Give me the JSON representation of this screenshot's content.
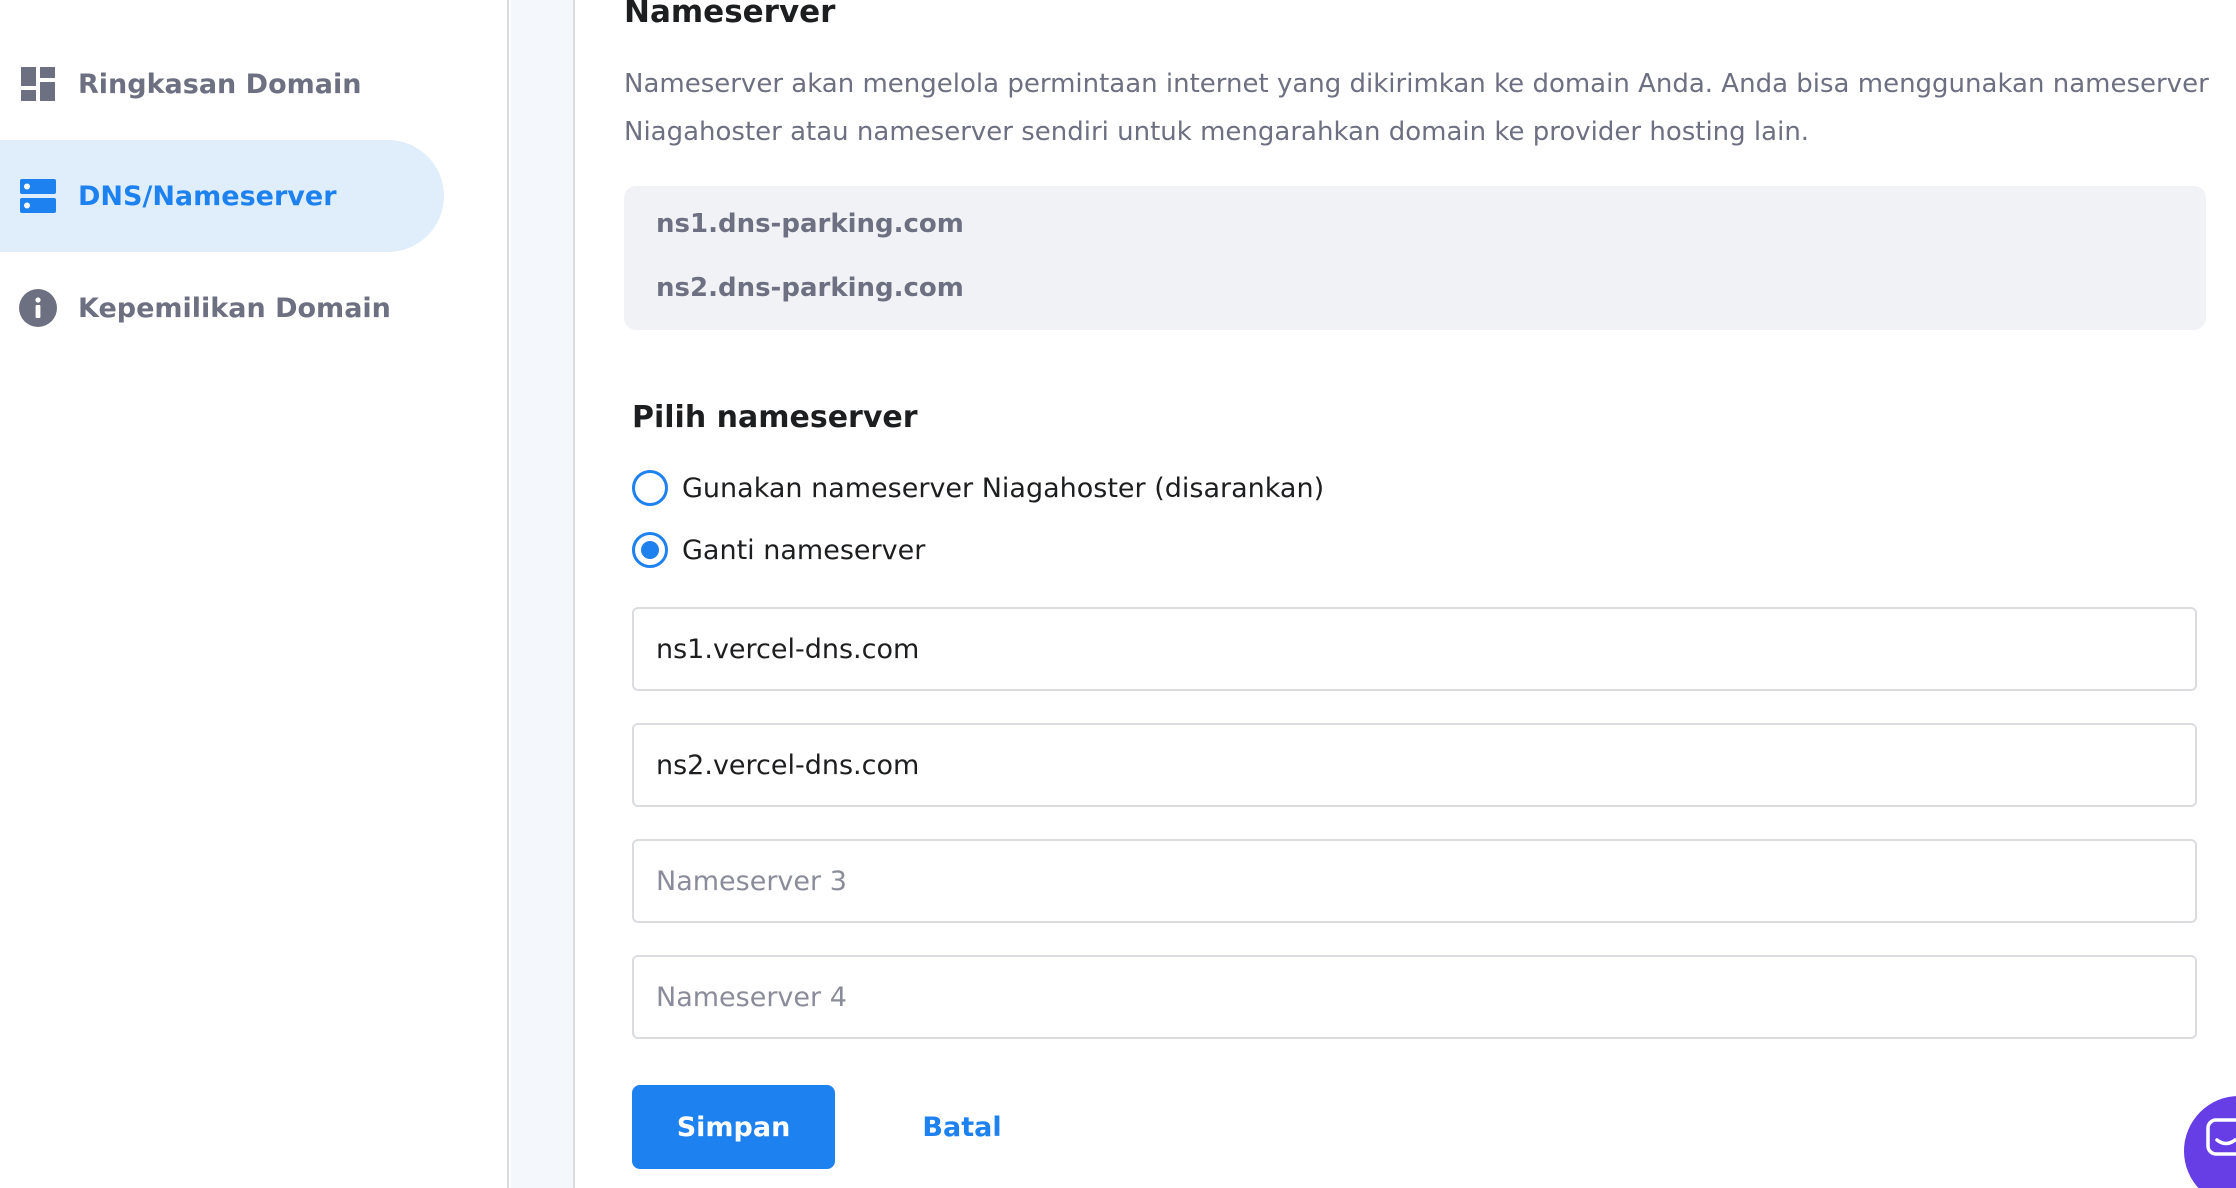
{
  "sidebar": {
    "items": [
      {
        "label": "Ringkasan Domain",
        "icon": "dashboard-icon",
        "active": false
      },
      {
        "label": "DNS/Nameserver",
        "icon": "dns-server-icon",
        "active": true
      },
      {
        "label": "Kepemilikan Domain",
        "icon": "info-icon",
        "active": false
      }
    ]
  },
  "main": {
    "section_title": "Nameserver",
    "section_description": "Nameserver akan mengelola permintaan internet yang dikirimkan ke domain Anda. Anda bisa menggunakan nameserver Niagahoster atau nameserver sendiri untuk mengarahkan domain ke provider hosting lain.",
    "current_nameservers": [
      "ns1.dns-parking.com",
      "ns2.dns-parking.com"
    ],
    "choose_title": "Pilih nameserver",
    "options": [
      {
        "label": "Gunakan nameserver Niagahoster (disarankan)",
        "selected": false
      },
      {
        "label": "Ganti nameserver",
        "selected": true
      }
    ],
    "inputs": [
      {
        "value": "ns1.vercel-dns.com",
        "placeholder": ""
      },
      {
        "value": "ns2.vercel-dns.com",
        "placeholder": ""
      },
      {
        "value": "",
        "placeholder": "Nameserver 3"
      },
      {
        "value": "",
        "placeholder": "Nameserver 4"
      }
    ],
    "save_label": "Simpan",
    "cancel_label": "Batal"
  },
  "colors": {
    "accent": "#1e81f0",
    "active_bg": "#e0eefc",
    "chat": "#673de6"
  },
  "chat": {
    "icon": "chat-icon"
  }
}
